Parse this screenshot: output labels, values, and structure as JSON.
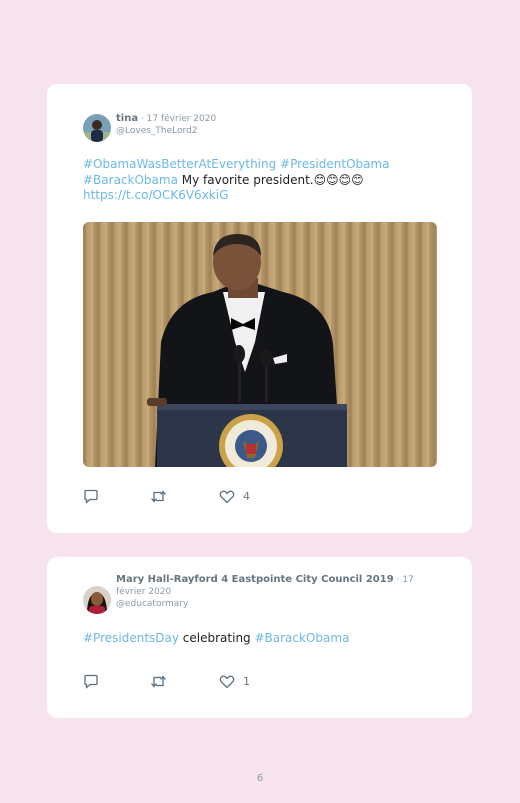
{
  "tweets": [
    {
      "name": "tina",
      "date": " · 17 février 2020",
      "handle": "@Loves_TheLord2",
      "tags_line1": "#ObamaWasBetterAtEverything #PresidentObama",
      "tag_line2": "#BarackObama",
      "text_line2": " My favorite president.😊😊😊😊",
      "link": "https://t.co/OCK6V6xkiG",
      "media_alt": "Barack Obama at a podium with presidential seal",
      "likes": "4",
      "icons": [
        "reply-icon",
        "retweet-icon",
        "like-icon"
      ]
    },
    {
      "name": "Mary Hall-Rayford 4 Eastpointe City Council 2019",
      "date": " · 17 février 2020",
      "handle": "@educatormary",
      "tag1": "#PresidentsDay",
      "text_mid": " celebrating ",
      "tag2": "#BarackObama",
      "likes": "1",
      "icons": [
        "reply-icon",
        "retweet-icon",
        "like-icon"
      ]
    }
  ],
  "page_number": "6",
  "colors": {
    "background": "#f6e3ee",
    "link": "#6bb8e6",
    "card": "#ffffff"
  }
}
